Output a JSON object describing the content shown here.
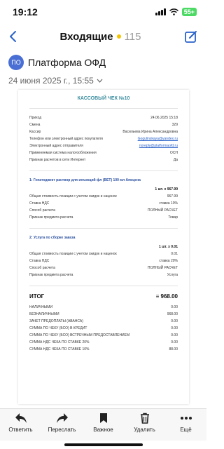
{
  "status": {
    "time": "19:12",
    "battery": "55+"
  },
  "nav": {
    "title": "Входящие",
    "count": "115"
  },
  "sender": {
    "avatar": "ПО",
    "name": "Платформа ОФД"
  },
  "date": "24 июня 2025 г., 15:55",
  "receipt": {
    "title": "КАССОВЫЙ ЧЕК №10",
    "header_rows": [
      {
        "label": "Приход",
        "value": "24.06.2025 15:18"
      },
      {
        "label": "Смена",
        "value": "329"
      },
      {
        "label": "Кассир",
        "value": "Васильева Ирина Александровна"
      },
      {
        "label": "Телефон или электронный адрес покупателя",
        "value": "Gogulinskaya@yandex.ru",
        "link": true
      },
      {
        "label": "Электронный адрес отправителя",
        "value": "noreply@platformaofd.ru",
        "link": true
      },
      {
        "label": "Применяемая система налогообложения",
        "value": "ОСН"
      },
      {
        "label": "Признак расчетов в сети Интернет",
        "value": "Да"
      }
    ],
    "items": [
      {
        "name": "1: Гепатоджект раствор для инъекций фл (ВЕТ) 100 мл Апицена",
        "qty": "1 шт. x 967.99",
        "rows": [
          {
            "label": "Общая стоимость позиции с учетом скидок и наценок",
            "value": "967.99"
          },
          {
            "label": "Ставка НДС",
            "value": "ставка 10%"
          },
          {
            "label": "Способ расчета",
            "value": "ПОЛНЫЙ РАСЧЕТ"
          },
          {
            "label": "Признак предмета расчета",
            "value": "Товар"
          }
        ]
      },
      {
        "name": "2: Услуга по сборке заказа",
        "qty": "1 шт. x 0.01",
        "rows": [
          {
            "label": "Общая стоимость позиции с учетом скидок и наценок",
            "value": "0.01"
          },
          {
            "label": "Ставка НДС",
            "value": "ставка 20%"
          },
          {
            "label": "Способ расчета",
            "value": "ПОЛНЫЙ РАСЧЕТ"
          },
          {
            "label": "Признак предмета расчета",
            "value": "Услуга"
          }
        ]
      }
    ],
    "total": {
      "label": "ИТОГ",
      "value": "≡ 968.00"
    },
    "totals_rows": [
      {
        "label": "НАЛИЧНЫМИ",
        "value": "0.00"
      },
      {
        "label": "БЕЗНАЛИЧНЫМИ",
        "value": "968.00"
      },
      {
        "label": "ЗАЧЕТ ПРЕДОПЛАТЫ (АВАНСА)",
        "value": "0.00"
      },
      {
        "label": "СУММА ПО ЧЕКУ (БСО) В КРЕДИТ",
        "value": "0.00"
      },
      {
        "label": "СУММА ПО ЧЕКУ (БСО) ВСТРЕЧНЫМ ПРЕДОСТАВЛЕНИЕМ",
        "value": "0.00"
      },
      {
        "label": "СУММА НДС ЧЕКА ПО СТАВКЕ 20%",
        "value": "0.00"
      },
      {
        "label": "СУММА НДС ЧЕКА ПО СТАВКЕ 10%",
        "value": "88.00"
      }
    ]
  },
  "toolbar": [
    {
      "label": "Ответить",
      "icon": "reply-icon"
    },
    {
      "label": "Переслать",
      "icon": "forward-icon"
    },
    {
      "label": "Важное",
      "icon": "bookmark-icon"
    },
    {
      "label": "Удалить",
      "icon": "trash-icon"
    },
    {
      "label": "Ещё",
      "icon": "more-icon"
    }
  ],
  "colors": {
    "accent": "#2a62c9",
    "avatar": "#4a6fd4",
    "unread_dot": "#f5c400",
    "receipt_title": "#3d8ea0",
    "battery": "#4cd964"
  }
}
